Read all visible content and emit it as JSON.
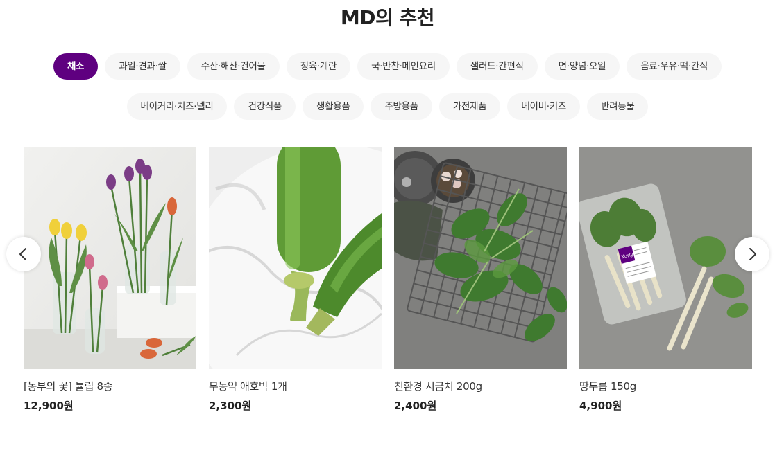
{
  "section_title": "MD의 추천",
  "categories_row1": [
    "채소",
    "과일·견과·쌀",
    "수산·해산·건어물",
    "정육·계란",
    "국·반찬·메인요리",
    "샐러드·간편식",
    "면·양념·오일",
    "음료·우유·떡·간식"
  ],
  "categories_row2": [
    "베이커리·치즈·델리",
    "건강식품",
    "생활용품",
    "주방용품",
    "가전제품",
    "베이비·키즈",
    "반려동물"
  ],
  "active_category": "채소",
  "products": [
    {
      "name": "[농부의 꽃] 튤립 8종",
      "price": "12,900원",
      "image": "tulips-in-glass-vases"
    },
    {
      "name": "무농약 애호박 1개",
      "price": "2,300원",
      "image": "zucchini-on-marble-plate"
    },
    {
      "name": "친환경 시금치 200g",
      "price": "2,400원",
      "image": "spinach-on-wire-rack"
    },
    {
      "name": "땅두릅 150g",
      "price": "4,900원",
      "image": "aralia-shoots-in-package"
    }
  ],
  "pack_label": "Kurly",
  "nav": {
    "prev_icon": "chevron-left-icon",
    "next_icon": "chevron-right-icon"
  },
  "colors": {
    "accent": "#5f0080",
    "chip_bg": "#f6f6f6"
  }
}
